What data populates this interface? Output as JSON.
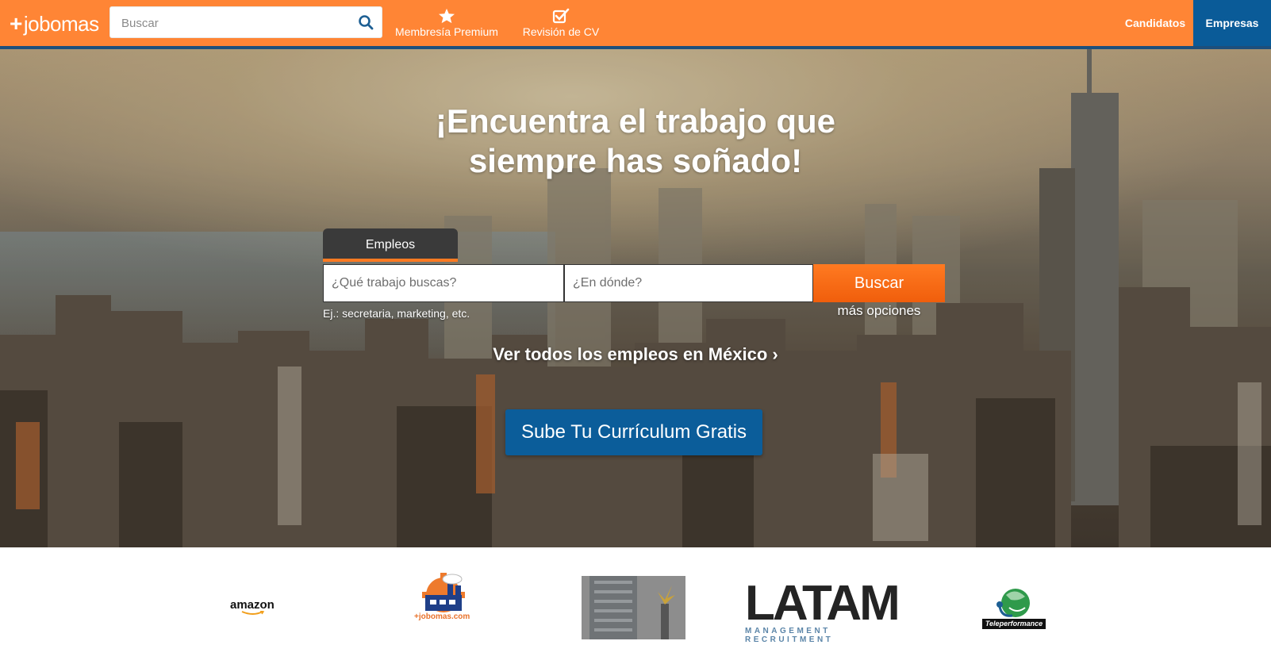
{
  "header": {
    "logo_plus": "+",
    "logo_word": "jobomas",
    "search_placeholder": "Buscar",
    "nav": {
      "premium_label": "Membresía Premium",
      "cv_label": "Revisión de CV",
      "candidatos_label": "Candidatos",
      "empresas_label": "Empresas"
    }
  },
  "hero": {
    "headline_line1": "¡Encuentra el trabajo que",
    "headline_line2": "siempre has soñado!",
    "tab_label": "Empleos",
    "what_placeholder": "¿Qué trabajo buscas?",
    "where_placeholder": "¿En dónde?",
    "search_button": "Buscar",
    "hint": "Ej.: secretaria, marketing, etc.",
    "more_options": "más opciones",
    "see_all": "Ver todos los empleos en México ›",
    "upload_cv_button": "Sube Tu Currículum Gratis"
  },
  "logos": {
    "amazon": "amazon",
    "jobomas_caption": "+jobomas.com",
    "latam_big": "LATAM",
    "latam_sub": "MANAGEMENT RECRUITMENT",
    "teleperformance": "Teleperformance"
  },
  "colors": {
    "brand_orange": "#ff8535",
    "nav_blue": "#0a5b98",
    "button_orange": "#f26414",
    "cv_button_blue": "#0b5d9a"
  }
}
